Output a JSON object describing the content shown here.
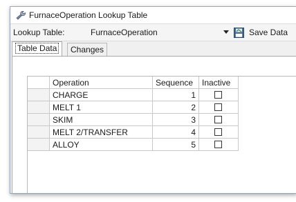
{
  "window": {
    "title": "FurnaceOperation Lookup Table",
    "title_icon": "wrench-icon"
  },
  "toolbar": {
    "lookup_label": "Lookup Table:",
    "lookup_value": "FurnaceOperation",
    "save_icon": "save-data-icon",
    "save_label": "Save Data"
  },
  "tabs": [
    {
      "label": "Table Data",
      "active": true
    },
    {
      "label": "Changes",
      "active": false
    }
  ],
  "table": {
    "columns": [
      "Operation",
      "Sequence",
      "Inactive"
    ],
    "rows": [
      {
        "operation": "CHARGE",
        "sequence": "1",
        "inactive": false
      },
      {
        "operation": "MELT 1",
        "sequence": "2",
        "inactive": false
      },
      {
        "operation": "SKIM",
        "sequence": "3",
        "inactive": false
      },
      {
        "operation": "MELT 2/TRANSFER",
        "sequence": "4",
        "inactive": false
      },
      {
        "operation": "ALLOY",
        "sequence": "5",
        "inactive": false
      }
    ]
  }
}
